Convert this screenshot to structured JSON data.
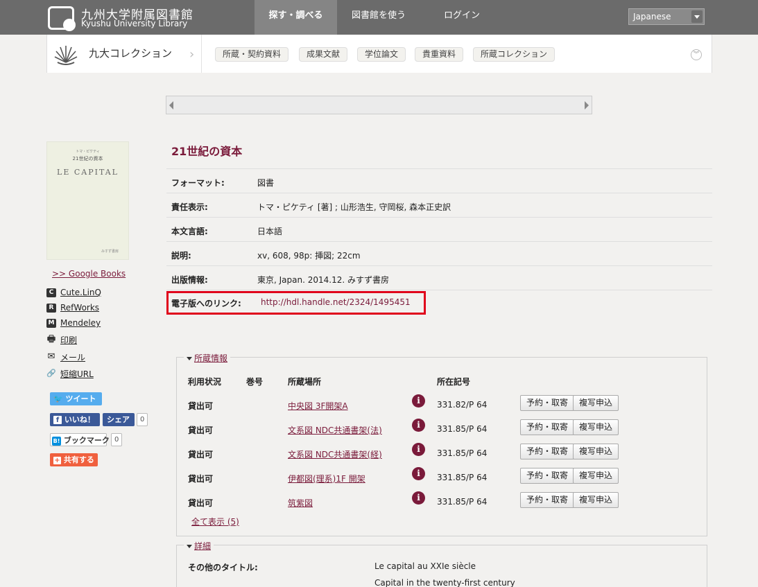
{
  "header": {
    "logo_jp": "九州大学附属図書館",
    "logo_en": "Kyushu University Library",
    "nav": [
      "探す・調べる",
      "図書館を使う",
      "ログイン"
    ],
    "language": "Japanese"
  },
  "collection_bar": {
    "title": "九大コレクション",
    "tags": [
      "所蔵・契約資料",
      "成果文献",
      "学位論文",
      "貴重資料",
      "所蔵コレクション"
    ]
  },
  "cover": {
    "line1": "トマ・ピケティ",
    "line2": "21世紀の資本",
    "line3": "LE CAPITAL",
    "publisher": "みすず書房"
  },
  "sidebar": {
    "google_books": ">> Google Books",
    "links": [
      {
        "label": "Cute.LinQ",
        "icon": "cutelinq-icon",
        "glyph": "C"
      },
      {
        "label": "RefWorks",
        "icon": "refworks-icon",
        "glyph": "R"
      },
      {
        "label": "Mendeley",
        "icon": "mendeley-icon",
        "glyph": "M"
      },
      {
        "label": "印刷",
        "icon": "print-icon",
        "glyph": "🖶"
      },
      {
        "label": "メール",
        "icon": "mail-icon",
        "glyph": "✉"
      },
      {
        "label": "短縮URL",
        "icon": "link-icon",
        "glyph": "🔗"
      }
    ],
    "tweet": "ツイート",
    "like": "いいね！",
    "share": "シェア",
    "like_count": "0",
    "bookmark": "ブックマーク",
    "bookmark_count": "0",
    "share_plus": "共有する",
    "colors": {
      "twitter": "#55acee",
      "facebook": "#3b5998",
      "hatena": "#008fde",
      "share": "#f0603e"
    }
  },
  "record": {
    "title": "21世紀の資本",
    "fields": [
      {
        "key": "フォーマット:",
        "value": "図書"
      },
      {
        "key": "責任表示:",
        "value": "トマ・ピケティ [著] ; 山形浩生, 守岡桜, 森本正史訳"
      },
      {
        "key": "本文言語:",
        "value": "日本語"
      },
      {
        "key": "説明:",
        "value": "xv, 608, 98p: 挿図; 22cm"
      },
      {
        "key": "出版情報:",
        "value": "東京, Japan. 2014.12. みすず書房"
      }
    ],
    "link_key": "電子版へのリンク:",
    "link_value": "http://hdl.handle.net/2324/1495451"
  },
  "holdings": {
    "legend": "所蔵情報",
    "headers": [
      "利用状況",
      "巻号",
      "所蔵場所",
      "所在記号"
    ],
    "rows": [
      {
        "status": "貸出可",
        "location": "中央図 3F開架A",
        "call": "331.82/P 64"
      },
      {
        "status": "貸出可",
        "location": "文系図 NDC共通書架(法)",
        "call": "331.85/P 64"
      },
      {
        "status": "貸出可",
        "location": "文系図 NDC共通書架(経)",
        "call": "331.85/P 64"
      },
      {
        "status": "貸出可",
        "location": "伊都図(理系)1F 開架",
        "call": "331.85/P 64"
      },
      {
        "status": "貸出可",
        "location": "筑紫図",
        "call": "331.85/P 64"
      }
    ],
    "reserve_label": "予約・取寄",
    "copy_label": "複写申込",
    "show_all": "全て表示 (5)"
  },
  "details": {
    "legend": "詳細",
    "other_title_key": "その他のタイトル:",
    "other_titles": [
      "Le capital au XXIe siècle",
      "Capital in the twenty-first century"
    ]
  }
}
